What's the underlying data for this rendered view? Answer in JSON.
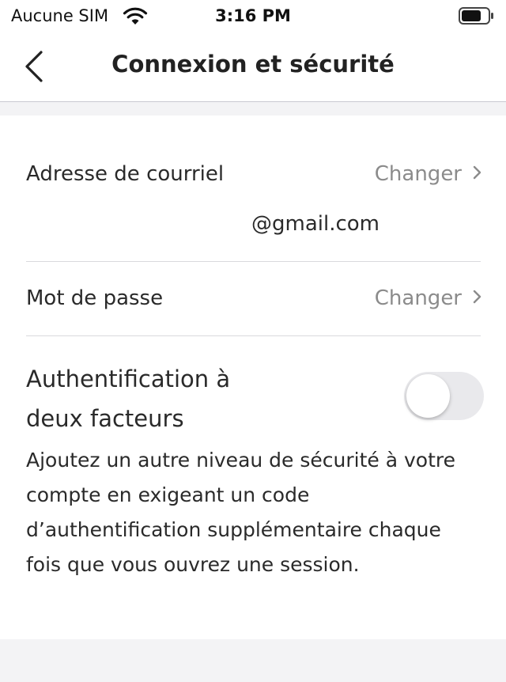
{
  "status_bar": {
    "carrier": "Aucune SIM",
    "time": "3:16 PM"
  },
  "nav": {
    "title": "Connexion et sécurité",
    "back_icon": "chevron-left-icon"
  },
  "email_row": {
    "label": "Adresse de courriel",
    "action": "Changer",
    "value": "@gmail.com"
  },
  "password_row": {
    "label": "Mot de passe",
    "action": "Changer"
  },
  "two_factor": {
    "title": "Authentification à deux facteurs",
    "enabled": false,
    "description": "Ajoutez un autre niveau de sécurité à votre compte en exigeant un code d’authentification supplémentaire chaque fois que vous ouvrez une session."
  },
  "colors": {
    "background": "#f3f3f5",
    "card": "#ffffff",
    "muted_text": "#8b8b8b",
    "toggle_off": "#e9e9ec"
  }
}
